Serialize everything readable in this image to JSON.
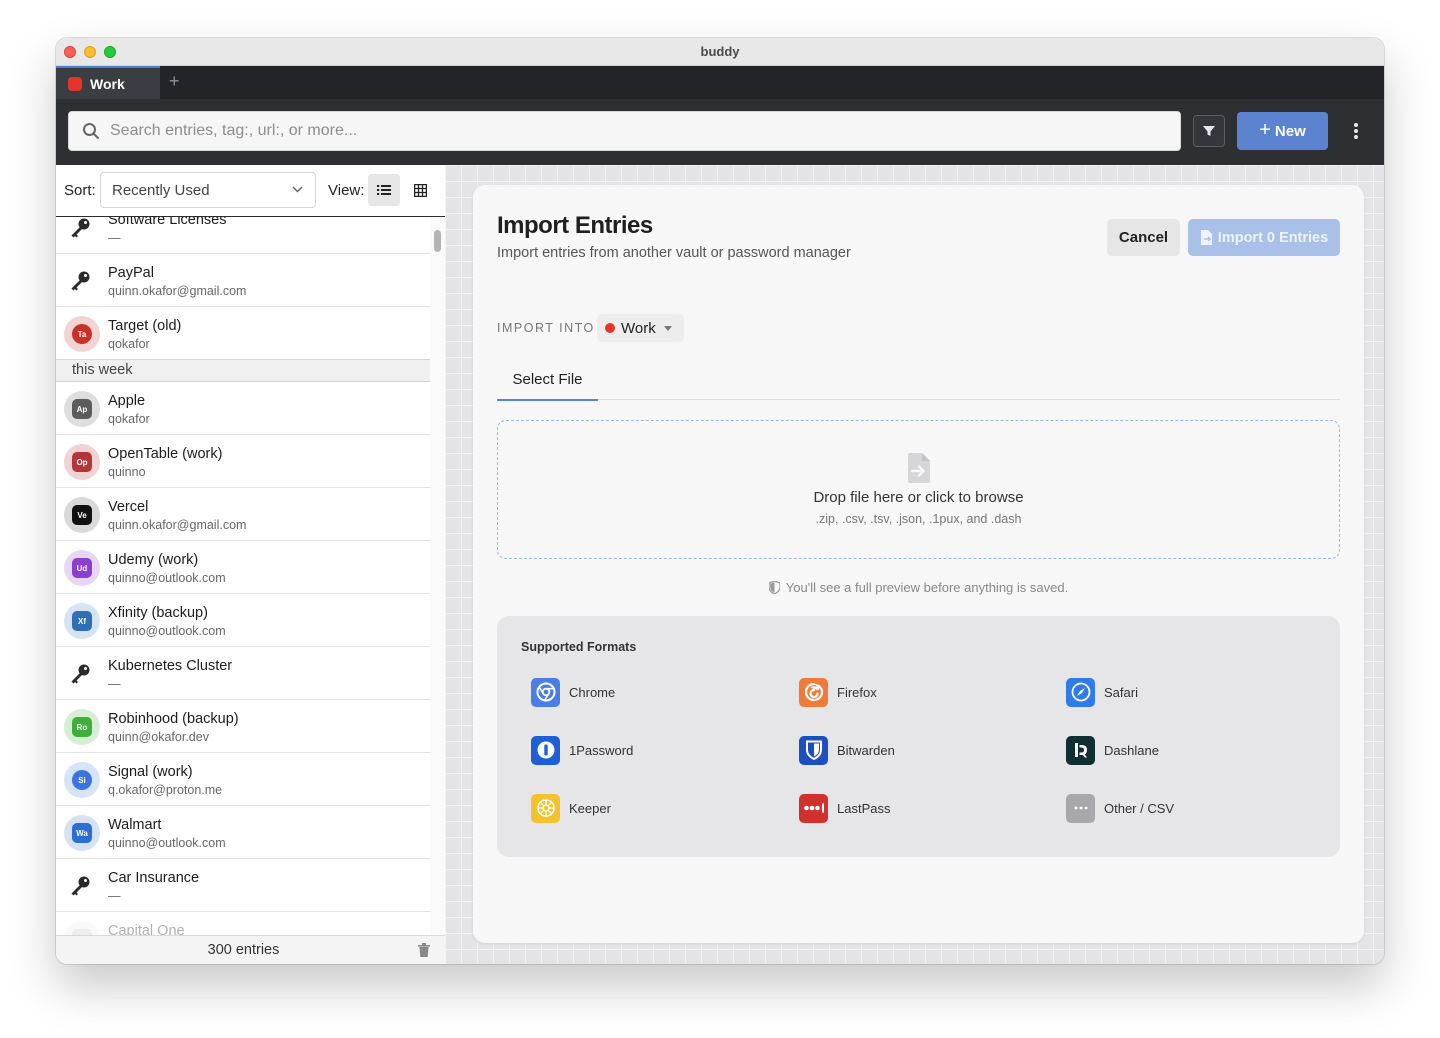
{
  "window": {
    "title": "buddy"
  },
  "tabs": [
    {
      "label": "Work",
      "color": "#e5352b"
    }
  ],
  "toolbar": {
    "search_placeholder": "Search entries, tag:, url:, or more...",
    "new_label": "New"
  },
  "sidebar": {
    "sort_label": "Sort:",
    "sort_value": "Recently Used",
    "view_label": "View:",
    "entries_before_group": [
      {
        "title": "Software Licenses",
        "subtitle": "—",
        "icon": "key-icon"
      },
      {
        "title": "PayPal",
        "subtitle": "quinn.okafor@gmail.com",
        "icon": "key-icon"
      },
      {
        "title": "Target (old)",
        "subtitle": "qokafor",
        "badge": "Ta",
        "color": "#c8312a",
        "ring": "#f2d4d2"
      }
    ],
    "group_label": "this week",
    "entries": [
      {
        "title": "Apple",
        "subtitle": "qokafor",
        "badge": "Ap",
        "color": "#5c5c5c",
        "ring": "#dedede"
      },
      {
        "title": "OpenTable (work)",
        "subtitle": "quinno",
        "badge": "Op",
        "color": "#b5353a",
        "ring": "#f0d3d4"
      },
      {
        "title": "Vercel",
        "subtitle": "quinn.okafor@gmail.com",
        "badge": "Ve",
        "color": "#111111",
        "ring": "#d9d9d9"
      },
      {
        "title": "Udemy (work)",
        "subtitle": "quinno@outlook.com",
        "badge": "Ud",
        "color": "#8a3fd1",
        "ring": "#e7d7f5"
      },
      {
        "title": "Xfinity (backup)",
        "subtitle": "quinno@outlook.com",
        "badge": "Xf",
        "color": "#2f6fb8",
        "ring": "#d5e3f3"
      },
      {
        "title": "Kubernetes Cluster",
        "subtitle": "—",
        "icon": "key-icon"
      },
      {
        "title": "Robinhood (backup)",
        "subtitle": "quinn@okafor.dev",
        "badge": "Ro",
        "color": "#3fae3a",
        "ring": "#d6efd4"
      },
      {
        "title": "Signal (work)",
        "subtitle": "q.okafor@proton.me",
        "badge": "Si",
        "color": "#3a74e0",
        "ring": "#d6e3f8"
      },
      {
        "title": "Walmart",
        "subtitle": "quinno@outlook.com",
        "badge": "Wa",
        "color": "#2c6ed6",
        "ring": "#d5e2f6"
      },
      {
        "title": "Car Insurance",
        "subtitle": "—",
        "icon": "key-icon"
      },
      {
        "title": "Capital One",
        "subtitle": "",
        "badge": "",
        "color": "#cccccc",
        "ring": "#eeeeee"
      }
    ],
    "footer_count": "300 entries"
  },
  "import": {
    "title": "Import Entries",
    "subtitle": "Import entries from another vault or password manager",
    "cancel_label": "Cancel",
    "import_label": "Import 0 Entries",
    "into_label": "IMPORT INTO",
    "into_value": "Work",
    "tab_label": "Select File",
    "drop_title": "Drop file here or click to browse",
    "drop_formats": ".zip, .csv, .tsv, .json, .1pux, and .dash",
    "preview_note": "You'll see a full preview before anything is saved.",
    "formats_title": "Supported Formats",
    "formats": [
      {
        "label": "Chrome",
        "icon": "chrome-icon",
        "color": "#4a7ee6"
      },
      {
        "label": "Firefox",
        "icon": "firefox-icon",
        "color": "#f07a3a"
      },
      {
        "label": "Safari",
        "icon": "safari-icon",
        "color": "#2f7bea"
      },
      {
        "label": "1Password",
        "icon": "onepassword-icon",
        "color": "#1e5fd6"
      },
      {
        "label": "Bitwarden",
        "icon": "bitwarden-icon",
        "color": "#1c4fc0"
      },
      {
        "label": "Dashlane",
        "icon": "dashlane-icon",
        "color": "#0f2f33"
      },
      {
        "label": "Keeper",
        "icon": "keeper-icon",
        "color": "#f4c22e"
      },
      {
        "label": "LastPass",
        "icon": "lastpass-icon",
        "color": "#d0312d"
      },
      {
        "label": "Other / CSV",
        "icon": "more-icon",
        "color": "#a8a8ac"
      }
    ]
  }
}
